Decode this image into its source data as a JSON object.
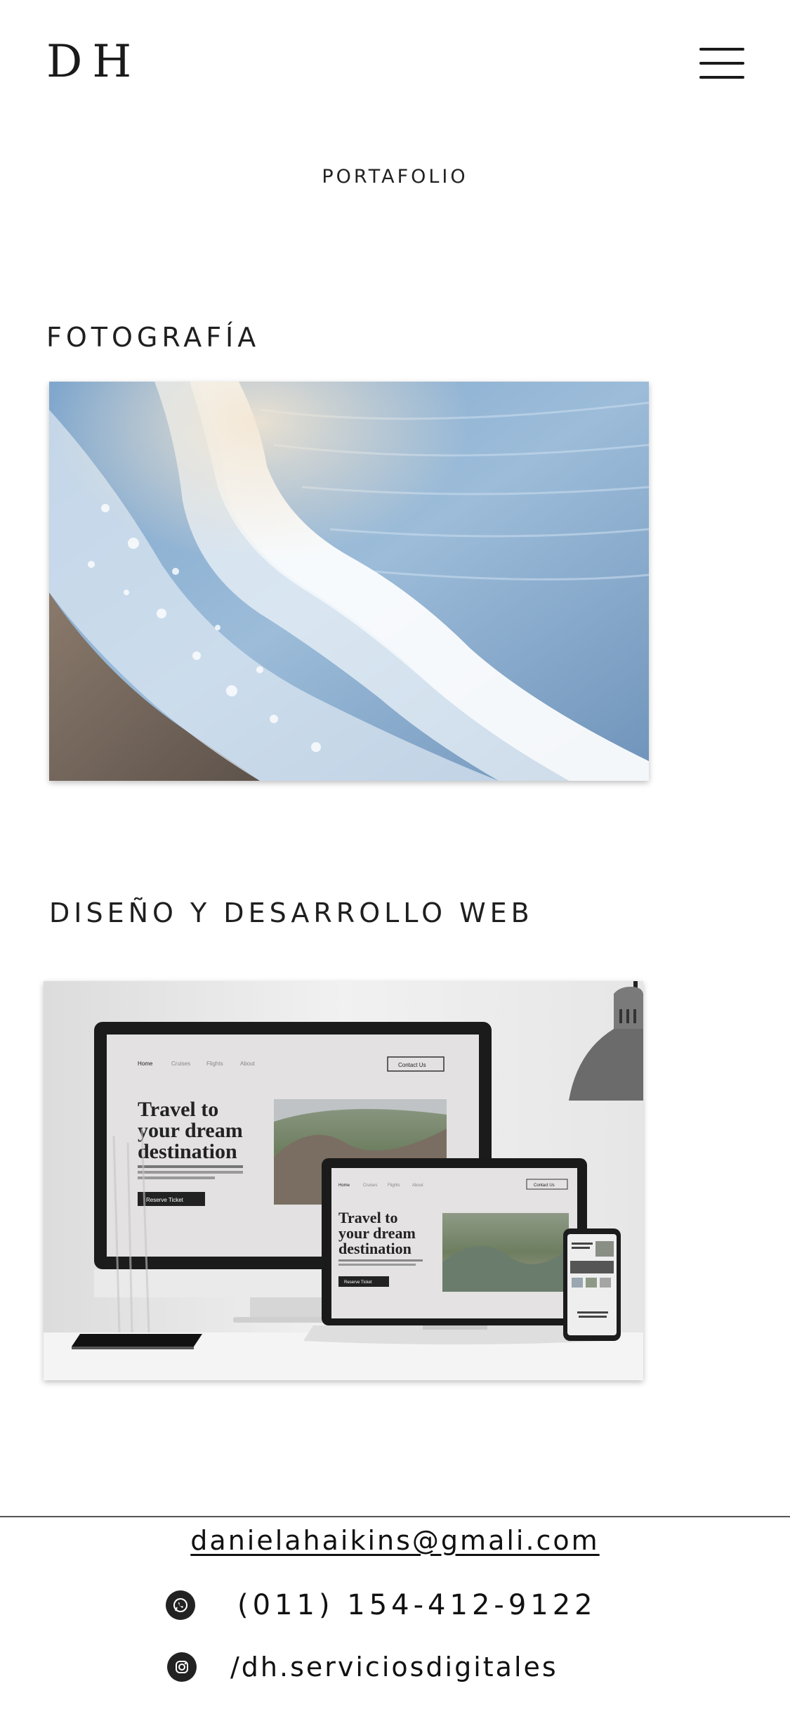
{
  "header": {
    "logo": "DH",
    "menu_icon": "hamburger-menu-icon"
  },
  "nav": {
    "title": "PORTAFOLIO"
  },
  "sections": {
    "photography": {
      "title": "FOTOGRAFÍA",
      "image_subject": "ocean wave on beach"
    },
    "web": {
      "title": "DISEÑO Y DESARROLLO WEB",
      "image_subject": "responsive website mockup on desktop, laptop and phone",
      "mockup": {
        "nav_home": "Home",
        "nav_cruises": "Cruises",
        "nav_flights": "Flights",
        "nav_about": "About",
        "contact_button": "Contact Us",
        "headline_1": "Travel to",
        "headline_2": "your dream",
        "headline_3": "destination",
        "reserve_button": "Reserve Ticket"
      }
    }
  },
  "footer": {
    "email": "danielahaikins@gmali.com",
    "phone": "(011) 154-412-9122",
    "phone_icon": "whatsapp-icon",
    "instagram": "/dh.serviciosdigitales",
    "instagram_icon": "instagram-icon"
  },
  "colors": {
    "background": "#ffffff",
    "text": "#1a1a1a",
    "sea_blue": "#8fb4d6"
  }
}
